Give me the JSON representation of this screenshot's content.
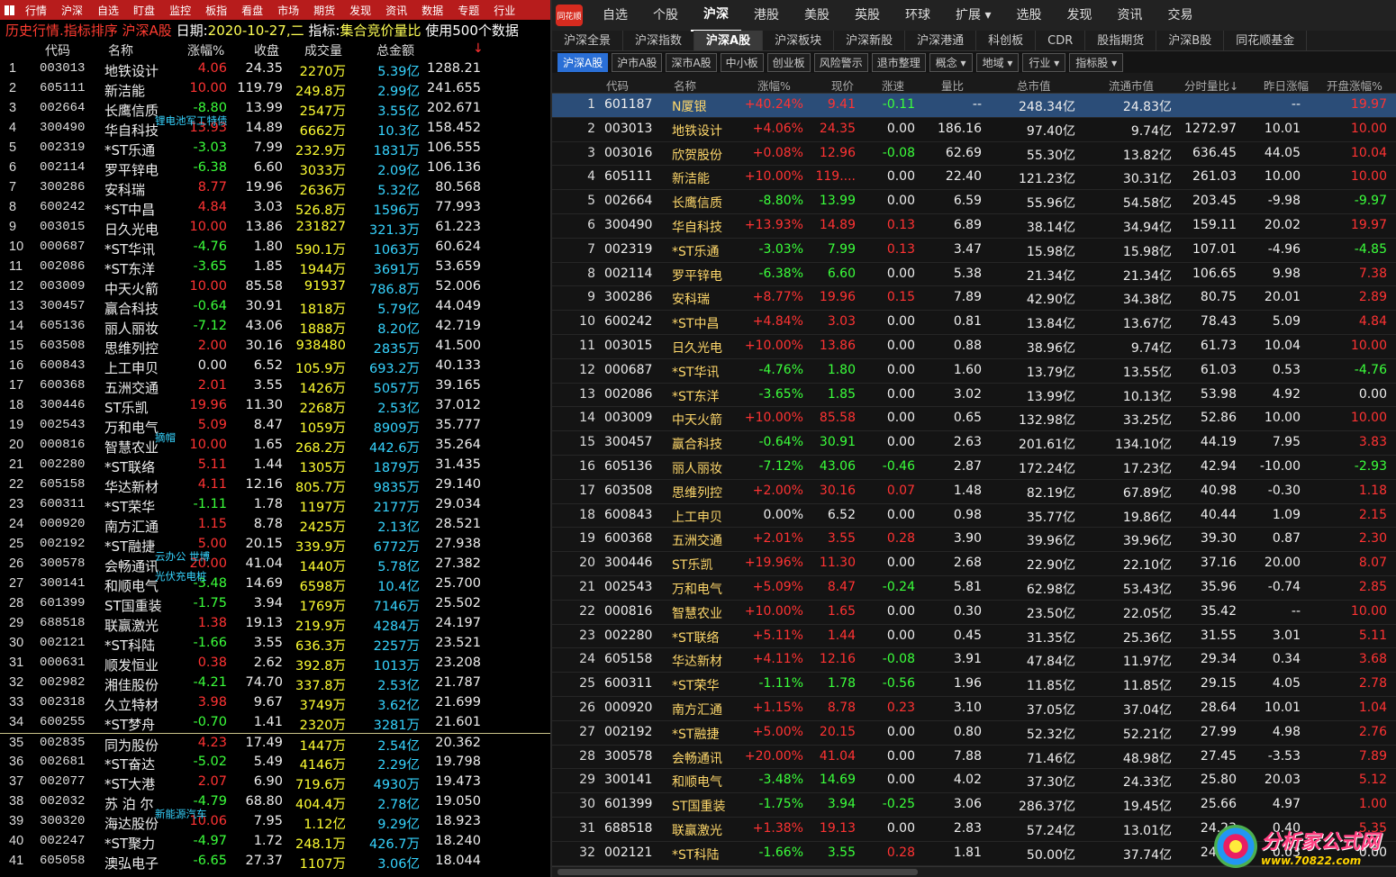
{
  "left": {
    "menu": [
      "行情",
      "沪深",
      "自选",
      "盯盘",
      "监控",
      "板指",
      "看盘",
      "市场",
      "期货",
      "发现",
      "资讯",
      "数据",
      "专题",
      "行业"
    ],
    "bar": {
      "title": "历史行情.指标排序 沪深A股",
      "date_label": "日期:",
      "date": "2020-10-27,二",
      "index_label": "指标:",
      "index": "集合竞价量比",
      "use": "使用500个数据"
    },
    "headers": [
      "代码",
      "名称",
      "涨幅%",
      "收盘",
      "成交量",
      "总金额",
      "↓"
    ],
    "rows": [
      [
        "1",
        "003013",
        "地铁设计",
        "4.06",
        "24.35",
        "2270万",
        "5.39亿",
        "1288.21",
        "up"
      ],
      [
        "2",
        "605111",
        "新洁能",
        "10.00",
        "119.79",
        "249.8万",
        "2.99亿",
        "241.655",
        "up"
      ],
      [
        "3",
        "002664",
        "长鹰信质",
        "-8.80",
        "13.99",
        "2547万",
        "3.55亿",
        "202.671",
        "dn"
      ],
      [
        "4",
        "300490",
        "华自科技",
        "13.93",
        "14.89",
        "6662万",
        "10.3亿",
        "158.452",
        "up"
      ],
      [
        "5",
        "002319",
        "*ST乐通",
        "-3.03",
        "7.99",
        "232.9万",
        "1831万",
        "106.555",
        "dn"
      ],
      [
        "6",
        "002114",
        "罗平锌电",
        "-6.38",
        "6.60",
        "3033万",
        "2.09亿",
        "106.136",
        "dn"
      ],
      [
        "7",
        "300286",
        "安科瑞",
        "8.77",
        "19.96",
        "2636万",
        "5.32亿",
        "80.568",
        "up"
      ],
      [
        "8",
        "600242",
        "*ST中昌",
        "4.84",
        "3.03",
        "526.8万",
        "1596万",
        "77.993",
        "up"
      ],
      [
        "9",
        "003015",
        "日久光电",
        "10.00",
        "13.86",
        "231827",
        "321.3万",
        "61.223",
        "up"
      ],
      [
        "10",
        "000687",
        "*ST华讯",
        "-4.76",
        "1.80",
        "590.1万",
        "1063万",
        "60.624",
        "dn"
      ],
      [
        "11",
        "002086",
        "*ST东洋",
        "-3.65",
        "1.85",
        "1944万",
        "3691万",
        "53.659",
        "dn"
      ],
      [
        "12",
        "003009",
        "中天火箭",
        "10.00",
        "85.58",
        "91937",
        "786.8万",
        "52.006",
        "up"
      ],
      [
        "13",
        "300457",
        "赢合科技",
        "-0.64",
        "30.91",
        "1818万",
        "5.79亿",
        "44.049",
        "dn"
      ],
      [
        "14",
        "605136",
        "丽人丽妆",
        "-7.12",
        "43.06",
        "1888万",
        "8.20亿",
        "42.719",
        "dn"
      ],
      [
        "15",
        "603508",
        "思维列控",
        "2.00",
        "30.16",
        "938480",
        "2835万",
        "41.500",
        "up"
      ],
      [
        "16",
        "600843",
        "上工申贝",
        "0.00",
        "6.52",
        "105.9万",
        "693.2万",
        "40.133",
        "fl"
      ],
      [
        "17",
        "600368",
        "五洲交通",
        "2.01",
        "3.55",
        "1426万",
        "5057万",
        "39.165",
        "up"
      ],
      [
        "18",
        "300446",
        "ST乐凯",
        "19.96",
        "11.30",
        "2268万",
        "2.53亿",
        "37.012",
        "up"
      ],
      [
        "19",
        "002543",
        "万和电气",
        "5.09",
        "8.47",
        "1059万",
        "8909万",
        "35.777",
        "up"
      ],
      [
        "20",
        "000816",
        "智慧农业",
        "10.00",
        "1.65",
        "268.2万",
        "442.6万",
        "35.264",
        "up"
      ],
      [
        "21",
        "002280",
        "*ST联络",
        "5.11",
        "1.44",
        "1305万",
        "1879万",
        "31.435",
        "up"
      ],
      [
        "22",
        "605158",
        "华达新材",
        "4.11",
        "12.16",
        "805.7万",
        "9835万",
        "29.140",
        "up"
      ],
      [
        "23",
        "600311",
        "*ST荣华",
        "-1.11",
        "1.78",
        "1197万",
        "2177万",
        "29.034",
        "dn"
      ],
      [
        "24",
        "000920",
        "南方汇通",
        "1.15",
        "8.78",
        "2425万",
        "2.13亿",
        "28.521",
        "up"
      ],
      [
        "25",
        "002192",
        "*ST融捷",
        "5.00",
        "20.15",
        "339.9万",
        "6772万",
        "27.938",
        "up"
      ],
      [
        "26",
        "300578",
        "会畅通讯",
        "20.00",
        "41.04",
        "1440万",
        "5.78亿",
        "27.382",
        "up"
      ],
      [
        "27",
        "300141",
        "和顺电气",
        "-3.48",
        "14.69",
        "6598万",
        "10.4亿",
        "25.700",
        "dn"
      ],
      [
        "28",
        "601399",
        "ST国重装",
        "-1.75",
        "3.94",
        "1769万",
        "7146万",
        "25.502",
        "dn"
      ],
      [
        "29",
        "688518",
        "联赢激光",
        "1.38",
        "19.13",
        "219.9万",
        "4284万",
        "24.197",
        "up"
      ],
      [
        "30",
        "002121",
        "*ST科陆",
        "-1.66",
        "3.55",
        "636.3万",
        "2257万",
        "23.521",
        "dn"
      ],
      [
        "31",
        "000631",
        "顺发恒业",
        "0.38",
        "2.62",
        "392.8万",
        "1013万",
        "23.208",
        "up"
      ],
      [
        "32",
        "002982",
        "湘佳股份",
        "-4.21",
        "74.70",
        "337.8万",
        "2.53亿",
        "21.787",
        "dn"
      ],
      [
        "33",
        "002318",
        "久立特材",
        "3.98",
        "9.67",
        "3749万",
        "3.62亿",
        "21.699",
        "up"
      ],
      [
        "34",
        "600255",
        "*ST梦舟",
        "-0.70",
        "1.41",
        "2320万",
        "3281万",
        "21.601",
        "dn"
      ],
      [
        "35",
        "002835",
        "同为股份",
        "4.23",
        "17.49",
        "1447万",
        "2.54亿",
        "20.362",
        "up"
      ],
      [
        "36",
        "002681",
        "*ST奋达",
        "-5.02",
        "5.49",
        "4146万",
        "2.29亿",
        "19.798",
        "dn"
      ],
      [
        "37",
        "002077",
        "*ST大港",
        "2.07",
        "6.90",
        "719.6万",
        "4930万",
        "19.473",
        "up"
      ],
      [
        "38",
        "002032",
        "苏 泊 尔",
        "-4.79",
        "68.80",
        "404.4万",
        "2.78亿",
        "19.050",
        "dn"
      ],
      [
        "39",
        "300320",
        "海达股份",
        "10.06",
        "7.95",
        "1.12亿",
        "9.29亿",
        "18.923",
        "up"
      ],
      [
        "40",
        "002247",
        "*ST聚力",
        "-4.97",
        "1.72",
        "248.1万",
        "426.7万",
        "18.240",
        "dn"
      ],
      [
        "41",
        "605058",
        "澳弘电子",
        "-6.65",
        "27.37",
        "1107万",
        "3.06亿",
        "18.044",
        "dn"
      ]
    ],
    "tags": [
      {
        "row": 4,
        "text": "锂电池军工特债"
      },
      {
        "row": 20,
        "text": "摘帽"
      },
      {
        "row": 26,
        "text": "云办公 世博"
      },
      {
        "row": 27,
        "text": "光伏充电桩"
      },
      {
        "row": 39,
        "text": "新能源汽车"
      }
    ]
  },
  "right": {
    "top_tabs": [
      "自选",
      "个股",
      "沪深",
      "港股",
      "美股",
      "英股",
      "环球",
      "扩展 ▾",
      "选股",
      "发现",
      "资讯",
      "交易"
    ],
    "active_top": "沪深",
    "logo_text": "同花顺",
    "sub_tabs": [
      "沪深全景",
      "沪深指数",
      "沪深A股",
      "沪深板块",
      "沪深新股",
      "沪深港通",
      "科创板",
      "CDR",
      "股指期货",
      "沪深B股",
      "同花顺基金"
    ],
    "active_sub": "沪深A股",
    "filters": [
      "沪深A股",
      "沪市A股",
      "深市A股",
      "中小板",
      "创业板",
      "风险警示",
      "退市整理"
    ],
    "active_filter": "沪深A股",
    "dropdowns": [
      "概念 ▾",
      "地域 ▾",
      "行业 ▾",
      "指标股 ▾"
    ],
    "headers": [
      "代码",
      "名称",
      "涨幅%",
      "现价",
      "涨速",
      "量比",
      "总市值",
      "流通市值",
      "分时量比↓",
      "昨日涨幅",
      "开盘涨幅%"
    ],
    "rows": [
      [
        "1",
        "601187",
        "N厦银",
        "+40.24%",
        "9.41",
        "-0.11",
        "--",
        "248.34亿",
        "24.83亿",
        "",
        "--",
        "19.97",
        "up",
        "up",
        "dn",
        "up"
      ],
      [
        "2",
        "003013",
        "地铁设计",
        "+4.06%",
        "24.35",
        "0.00",
        "186.16",
        "97.40亿",
        "9.74亿",
        "1272.97",
        "10.01",
        "10.00",
        "up",
        "up",
        "fl",
        "up"
      ],
      [
        "3",
        "003016",
        "欣贺股份",
        "+0.08%",
        "12.96",
        "-0.08",
        "62.69",
        "55.30亿",
        "13.82亿",
        "636.45",
        "44.05",
        "10.04",
        "up",
        "up",
        "dn",
        "up"
      ],
      [
        "4",
        "605111",
        "新洁能",
        "+10.00%",
        "119....",
        "0.00",
        "22.40",
        "121.23亿",
        "30.31亿",
        "261.03",
        "10.00",
        "10.00",
        "up",
        "up",
        "fl",
        "up"
      ],
      [
        "5",
        "002664",
        "长鹰信质",
        "-8.80%",
        "13.99",
        "0.00",
        "6.59",
        "55.96亿",
        "54.58亿",
        "203.45",
        "-9.98",
        "-9.97",
        "dn",
        "dn",
        "fl",
        "dn"
      ],
      [
        "6",
        "300490",
        "华自科技",
        "+13.93%",
        "14.89",
        "0.13",
        "6.89",
        "38.14亿",
        "34.94亿",
        "159.11",
        "20.02",
        "19.97",
        "up",
        "up",
        "up",
        "up"
      ],
      [
        "7",
        "002319",
        "*ST乐通",
        "-3.03%",
        "7.99",
        "0.13",
        "3.47",
        "15.98亿",
        "15.98亿",
        "107.01",
        "-4.96",
        "-4.85",
        "dn",
        "dn",
        "up",
        "dn"
      ],
      [
        "8",
        "002114",
        "罗平锌电",
        "-6.38%",
        "6.60",
        "0.00",
        "5.38",
        "21.34亿",
        "21.34亿",
        "106.65",
        "9.98",
        "7.38",
        "dn",
        "dn",
        "fl",
        "up"
      ],
      [
        "9",
        "300286",
        "安科瑞",
        "+8.77%",
        "19.96",
        "0.15",
        "7.89",
        "42.90亿",
        "34.38亿",
        "80.75",
        "20.01",
        "2.89",
        "up",
        "up",
        "up",
        "up"
      ],
      [
        "10",
        "600242",
        "*ST中昌",
        "+4.84%",
        "3.03",
        "0.00",
        "0.81",
        "13.84亿",
        "13.67亿",
        "78.43",
        "5.09",
        "4.84",
        "up",
        "up",
        "fl",
        "up"
      ],
      [
        "11",
        "003015",
        "日久光电",
        "+10.00%",
        "13.86",
        "0.00",
        "0.88",
        "38.96亿",
        "9.74亿",
        "61.73",
        "10.04",
        "10.00",
        "up",
        "up",
        "fl",
        "up"
      ],
      [
        "12",
        "000687",
        "*ST华讯",
        "-4.76%",
        "1.80",
        "0.00",
        "1.60",
        "13.79亿",
        "13.55亿",
        "61.03",
        "0.53",
        "-4.76",
        "dn",
        "dn",
        "fl",
        "dn"
      ],
      [
        "13",
        "002086",
        "*ST东洋",
        "-3.65%",
        "1.85",
        "0.00",
        "3.02",
        "13.99亿",
        "10.13亿",
        "53.98",
        "4.92",
        "0.00",
        "dn",
        "dn",
        "fl",
        "fl"
      ],
      [
        "14",
        "003009",
        "中天火箭",
        "+10.00%",
        "85.58",
        "0.00",
        "0.65",
        "132.98亿",
        "33.25亿",
        "52.86",
        "10.00",
        "10.00",
        "up",
        "up",
        "fl",
        "up"
      ],
      [
        "15",
        "300457",
        "赢合科技",
        "-0.64%",
        "30.91",
        "0.00",
        "2.63",
        "201.61亿",
        "134.10亿",
        "44.19",
        "7.95",
        "3.83",
        "dn",
        "dn",
        "fl",
        "up"
      ],
      [
        "16",
        "605136",
        "丽人丽妆",
        "-7.12%",
        "43.06",
        "-0.46",
        "2.87",
        "172.24亿",
        "17.23亿",
        "42.94",
        "-10.00",
        "-2.93",
        "dn",
        "dn",
        "dn",
        "dn"
      ],
      [
        "17",
        "603508",
        "思维列控",
        "+2.00%",
        "30.16",
        "0.07",
        "1.48",
        "82.19亿",
        "67.89亿",
        "40.98",
        "-0.30",
        "1.18",
        "up",
        "up",
        "up",
        "up"
      ],
      [
        "18",
        "600843",
        "上工申贝",
        "0.00%",
        "6.52",
        "0.00",
        "0.98",
        "35.77亿",
        "19.86亿",
        "40.44",
        "1.09",
        "2.15",
        "fl",
        "fl",
        "fl",
        "up"
      ],
      [
        "19",
        "600368",
        "五洲交通",
        "+2.01%",
        "3.55",
        "0.28",
        "3.90",
        "39.96亿",
        "39.96亿",
        "39.30",
        "0.87",
        "2.30",
        "up",
        "up",
        "up",
        "up"
      ],
      [
        "20",
        "300446",
        "ST乐凯",
        "+19.96%",
        "11.30",
        "0.00",
        "2.68",
        "22.90亿",
        "22.10亿",
        "37.16",
        "20.00",
        "8.07",
        "up",
        "up",
        "fl",
        "up"
      ],
      [
        "21",
        "002543",
        "万和电气",
        "+5.09%",
        "8.47",
        "-0.24",
        "5.81",
        "62.98亿",
        "53.43亿",
        "35.96",
        "-0.74",
        "2.85",
        "up",
        "up",
        "dn",
        "up"
      ],
      [
        "22",
        "000816",
        "智慧农业",
        "+10.00%",
        "1.65",
        "0.00",
        "0.30",
        "23.50亿",
        "22.05亿",
        "35.42",
        "--",
        "10.00",
        "up",
        "up",
        "fl",
        "up"
      ],
      [
        "23",
        "002280",
        "*ST联络",
        "+5.11%",
        "1.44",
        "0.00",
        "0.45",
        "31.35亿",
        "25.36亿",
        "31.55",
        "3.01",
        "5.11",
        "up",
        "up",
        "fl",
        "up"
      ],
      [
        "24",
        "605158",
        "华达新材",
        "+4.11%",
        "12.16",
        "-0.08",
        "3.91",
        "47.84亿",
        "11.97亿",
        "29.34",
        "0.34",
        "3.68",
        "up",
        "up",
        "dn",
        "up"
      ],
      [
        "25",
        "600311",
        "*ST荣华",
        "-1.11%",
        "1.78",
        "-0.56",
        "1.96",
        "11.85亿",
        "11.85亿",
        "29.15",
        "4.05",
        "2.78",
        "dn",
        "dn",
        "dn",
        "up"
      ],
      [
        "26",
        "000920",
        "南方汇通",
        "+1.15%",
        "8.78",
        "0.23",
        "3.10",
        "37.05亿",
        "37.04亿",
        "28.64",
        "10.01",
        "1.04",
        "up",
        "up",
        "up",
        "up"
      ],
      [
        "27",
        "002192",
        "*ST融捷",
        "+5.00%",
        "20.15",
        "0.00",
        "0.80",
        "52.32亿",
        "52.21亿",
        "27.99",
        "4.98",
        "2.76",
        "up",
        "up",
        "fl",
        "up"
      ],
      [
        "28",
        "300578",
        "会畅通讯",
        "+20.00%",
        "41.04",
        "0.00",
        "7.88",
        "71.46亿",
        "48.98亿",
        "27.45",
        "-3.53",
        "7.89",
        "up",
        "up",
        "fl",
        "up"
      ],
      [
        "29",
        "300141",
        "和顺电气",
        "-3.48%",
        "14.69",
        "0.00",
        "4.02",
        "37.30亿",
        "24.33亿",
        "25.80",
        "20.03",
        "5.12",
        "dn",
        "dn",
        "fl",
        "up"
      ],
      [
        "30",
        "601399",
        "ST国重装",
        "-1.75%",
        "3.94",
        "-0.25",
        "3.06",
        "286.37亿",
        "19.45亿",
        "25.66",
        "4.97",
        "1.00",
        "dn",
        "dn",
        "dn",
        "up"
      ],
      [
        "31",
        "688518",
        "联赢激光",
        "+1.38%",
        "19.13",
        "0.00",
        "2.83",
        "57.24亿",
        "13.01亿",
        "24.23",
        "0.40",
        "5.35",
        "up",
        "up",
        "fl",
        "up"
      ],
      [
        "32",
        "002121",
        "*ST科陆",
        "-1.66%",
        "3.55",
        "0.28",
        "1.81",
        "50.00亿",
        "37.74亿",
        "24.21",
        "0.03",
        "0.00",
        "dn",
        "dn",
        "up",
        "fl"
      ]
    ]
  },
  "watermark": {
    "title": "分析家公式网",
    "url": "www.70822.com"
  },
  "colors": {
    "up": "#ff3333",
    "down": "#3bff3b",
    "flat": "#eeeeee",
    "menu_bg": "#b71c1c",
    "select_bg": "#2b4d78"
  }
}
